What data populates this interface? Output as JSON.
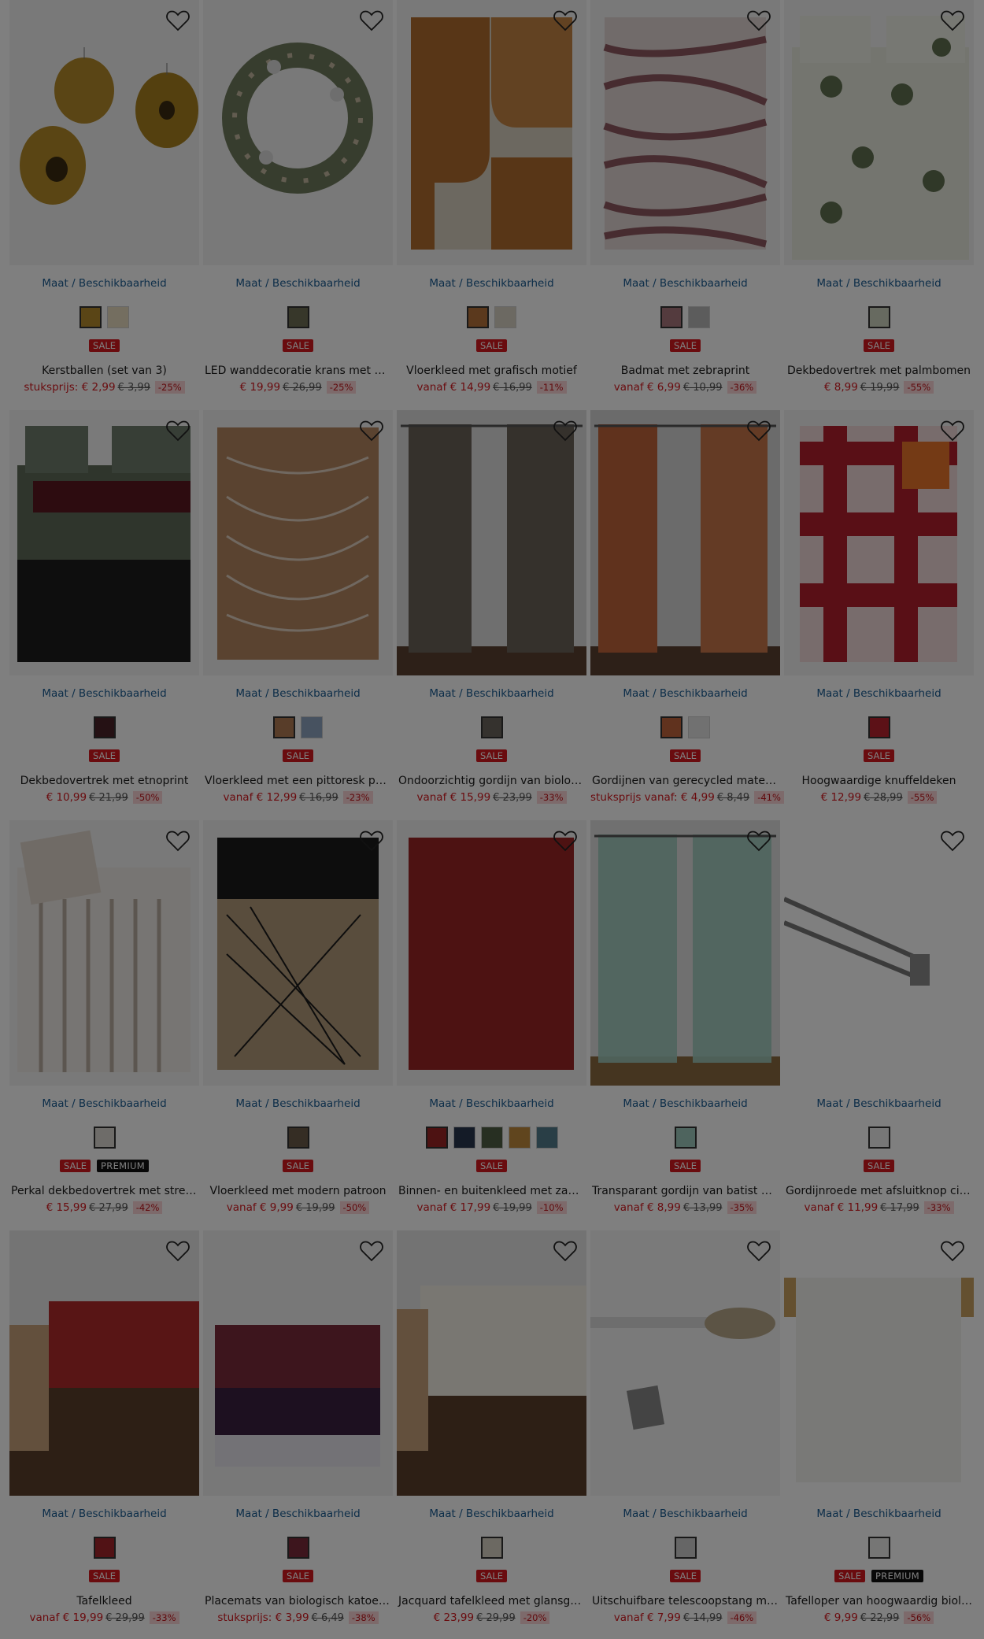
{
  "common": {
    "size_link": "Maat / Beschikbaarheid"
  },
  "products": [
    {
      "title": "Kerstballen (set van 3)",
      "prefix": "stuksprijs:",
      "price": "€ 2,99",
      "old": "€ 3,99",
      "discount": "-25%",
      "badges": [
        "SALE"
      ],
      "swatches": [
        "#b48a2c",
        "#e8dcc0"
      ],
      "image": "ornaments-image"
    },
    {
      "title": "LED wanddecoratie krans met blad...",
      "prefix": "",
      "price": "€ 19,99",
      "old": "€ 26,99",
      "discount": "-25%",
      "badges": [
        "SALE"
      ],
      "swatches": [
        "#6f6f55"
      ],
      "image": "wreath-image"
    },
    {
      "title": "Vloerkleed met grafisch motief",
      "prefix": "vanaf",
      "price": "€ 14,99",
      "old": "€ 16,99",
      "discount": "-11%",
      "badges": [
        "SALE"
      ],
      "swatches": [
        "#b7733a",
        "#d8d2c4"
      ],
      "image": "graphic-rug-image"
    },
    {
      "title": "Badmat met zebraprint",
      "prefix": "vanaf",
      "price": "€ 6,99",
      "old": "€ 10,99",
      "discount": "-36%",
      "badges": [
        "SALE"
      ],
      "swatches": [
        "#a9777d",
        "#b8b8b8"
      ],
      "image": "zebra-mat-image"
    },
    {
      "title": "Dekbedovertrek met palmbomen",
      "prefix": "",
      "price": "€ 8,99",
      "old": "€ 19,99",
      "discount": "-55%",
      "badges": [
        "SALE"
      ],
      "swatches": [
        "#cfd4c0"
      ],
      "image": "palm-bedding-image"
    },
    {
      "title": "Dekbedovertrek met etnoprint",
      "prefix": "",
      "price": "€ 10,99",
      "old": "€ 21,99",
      "discount": "-50%",
      "badges": [
        "SALE"
      ],
      "swatches": [
        "#4a2228"
      ],
      "image": "ethno-bedding-image"
    },
    {
      "title": "Vloerkleed met een pittoresk patr...",
      "prefix": "vanaf",
      "price": "€ 12,99",
      "old": "€ 16,99",
      "discount": "-23%",
      "badges": [
        "SALE"
      ],
      "swatches": [
        "#b07a52",
        "#8fa4c0"
      ],
      "image": "leaf-rug-image"
    },
    {
      "title": "Ondoorzichtig gordijn van biologisc...",
      "prefix": "vanaf",
      "price": "€ 15,99",
      "old": "€ 23,99",
      "discount": "-33%",
      "badges": [
        "SALE"
      ],
      "swatches": [
        "#6b645c"
      ],
      "image": "grey-curtain-image"
    },
    {
      "title": "Gordijnen van gerecycled materiaal...",
      "prefix": "stuksprijs vanaf:",
      "price": "€ 4,99",
      "old": "€ 8,49",
      "discount": "-41%",
      "badges": [
        "SALE"
      ],
      "swatches": [
        "#c0643d",
        "#e2e2e2"
      ],
      "image": "orange-curtain-image"
    },
    {
      "title": "Hoogwaardige knuffeldeken",
      "prefix": "",
      "price": "€ 12,99",
      "old": "€ 28,99",
      "discount": "-55%",
      "badges": [
        "SALE"
      ],
      "swatches": [
        "#b8222e"
      ],
      "image": "plaid-blanket-image"
    },
    {
      "title": "Perkal dekbedovertrek met strepen",
      "prefix": "",
      "price": "€ 15,99",
      "old": "€ 27,99",
      "discount": "-42%",
      "badges": [
        "SALE",
        "PREMIUM"
      ],
      "swatches": [
        "#dcd8d2"
      ],
      "image": "striped-bedding-image"
    },
    {
      "title": "Vloerkleed met modern patroon",
      "prefix": "vanaf",
      "price": "€ 9,99",
      "old": "€ 19,99",
      "discount": "-50%",
      "badges": [
        "SALE"
      ],
      "swatches": [
        "#6a5a48"
      ],
      "image": "modern-rug-image"
    },
    {
      "title": "Binnen- en buitenkleed met zacht o...",
      "prefix": "vanaf",
      "price": "€ 17,99",
      "old": "€ 19,99",
      "discount": "-10%",
      "badges": [
        "SALE"
      ],
      "swatches": [
        "#9a2424",
        "#28364e",
        "#4e5e44",
        "#c08a3c",
        "#527c8c"
      ],
      "image": "red-rug-image"
    },
    {
      "title": "Transparant gordijn van batist met ...",
      "prefix": "vanaf",
      "price": "€ 8,99",
      "old": "€ 13,99",
      "discount": "-35%",
      "badges": [
        "SALE"
      ],
      "swatches": [
        "#9cc8bc"
      ],
      "image": "sheer-curtain-image"
    },
    {
      "title": "Gordijnroede met afsluitknop cilin...",
      "prefix": "vanaf",
      "price": "€ 11,99",
      "old": "€ 17,99",
      "discount": "-33%",
      "badges": [
        "SALE"
      ],
      "swatches": [
        "#eeeeee"
      ],
      "image": "curtain-rod-image"
    },
    {
      "title": "Tafelkleed",
      "prefix": "vanaf",
      "price": "€ 19,99",
      "old": "€ 29,99",
      "discount": "-33%",
      "badges": [
        "SALE"
      ],
      "swatches": [
        "#a3252a"
      ],
      "image": "red-tablecloth-image"
    },
    {
      "title": "Placemats van biologisch katoen (s...",
      "prefix": "stuksprijs:",
      "price": "€ 3,99",
      "old": "€ 6,49",
      "discount": "-38%",
      "badges": [
        "SALE"
      ],
      "swatches": [
        "#7a2a3a"
      ],
      "image": "placemats-image"
    },
    {
      "title": "Jacquard tafelkleed met glansgaren",
      "prefix": "",
      "price": "€ 23,99",
      "old": "€ 29,99",
      "discount": "-20%",
      "badges": [
        "SALE"
      ],
      "swatches": [
        "#d9d3c4"
      ],
      "image": "jacquard-tablecloth-image"
    },
    {
      "title": "Uitschuifbare telescoopstang met ...",
      "prefix": "vanaf",
      "price": "€ 7,99",
      "old": "€ 14,99",
      "discount": "-46%",
      "badges": [
        "SALE"
      ],
      "swatches": [
        "#cccccc"
      ],
      "image": "telescope-rod-image"
    },
    {
      "title": "Tafelloper van hoogwaardig biologi...",
      "prefix": "",
      "price": "€ 9,99",
      "old": "€ 22,99",
      "discount": "-56%",
      "badges": [
        "SALE",
        "PREMIUM"
      ],
      "swatches": [
        "#ededea"
      ],
      "image": "table-runner-image"
    }
  ]
}
